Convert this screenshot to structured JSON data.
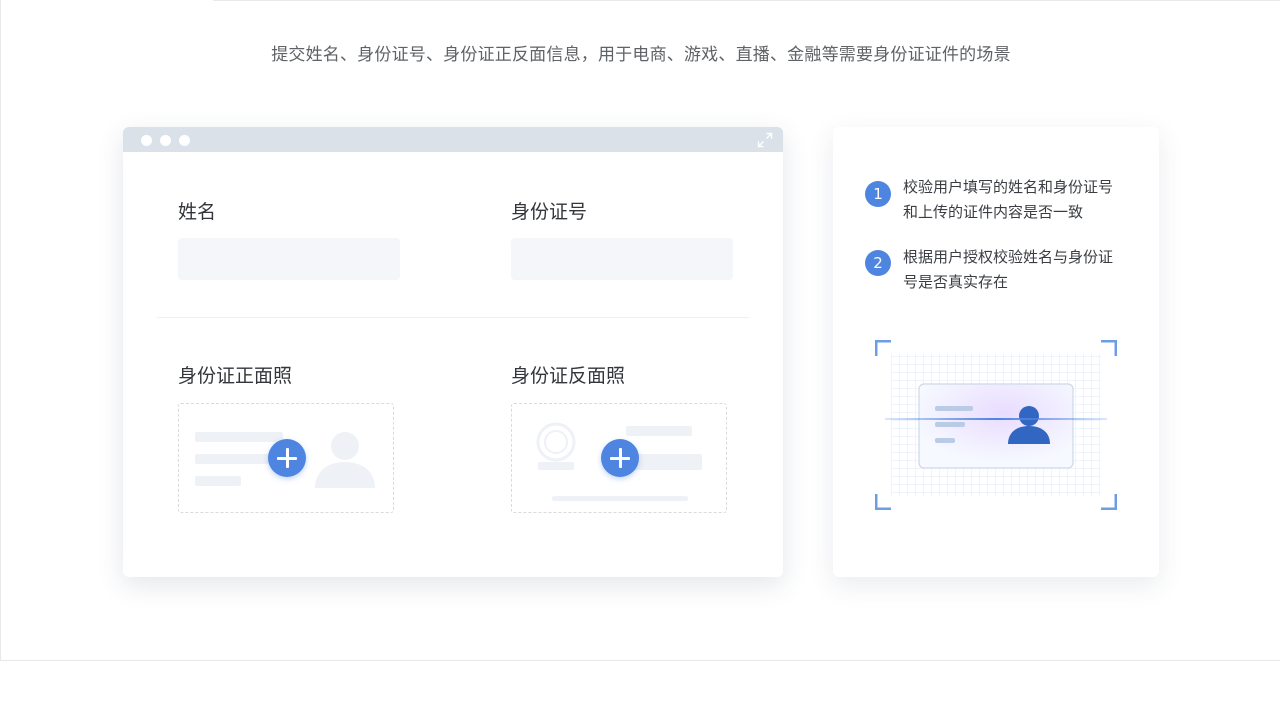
{
  "subtitle": "提交姓名、身份证号、身份证正反面信息，用于电商、游戏、直播、金融等需要身份证证件的场景",
  "form": {
    "name_label": "姓名",
    "id_number_label": "身份证号",
    "front_photo_label": "身份证正面照",
    "back_photo_label": "身份证反面照",
    "name_value": "",
    "id_number_value": ""
  },
  "info": {
    "steps": [
      {
        "num": "1",
        "text": "校验用户填写的姓名和身份证号和上传的证件内容是否一致"
      },
      {
        "num": "2",
        "text": "根据用户授权校验姓名与身份证号是否真实存在"
      }
    ]
  },
  "icons": {
    "upload": "plus-icon",
    "expand": "expand-icon",
    "portrait": "person-icon",
    "emblem": "emblem-icon",
    "scan": "id-card-scan-icon"
  },
  "colors": {
    "accent": "#4e85e1",
    "chrome": "#dbe1e9",
    "input_bg": "#f4f6f9"
  }
}
